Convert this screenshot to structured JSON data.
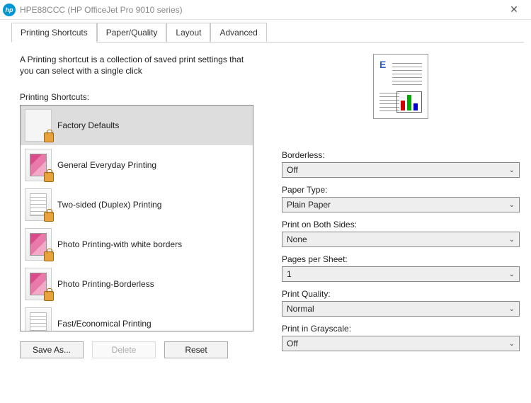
{
  "window": {
    "title": "HPE88CCC (HP OfficeJet Pro 9010 series)"
  },
  "tabs": [
    {
      "label": "Printing Shortcuts",
      "active": true
    },
    {
      "label": "Paper/Quality"
    },
    {
      "label": "Layout"
    },
    {
      "label": "Advanced"
    }
  ],
  "description": "A Printing shortcut is a collection of saved print settings that you can select with a single click",
  "shortcuts_label": "Printing Shortcuts:",
  "shortcuts": [
    {
      "label": "Factory Defaults",
      "thumb": "blank",
      "locked": true,
      "selected": true
    },
    {
      "label": "General Everyday Printing",
      "thumb": "photo",
      "locked": true
    },
    {
      "label": "Two-sided (Duplex) Printing",
      "thumb": "doc",
      "locked": true
    },
    {
      "label": "Photo Printing-with white borders",
      "thumb": "photo",
      "locked": true
    },
    {
      "label": "Photo Printing-Borderless",
      "thumb": "photo",
      "locked": true
    },
    {
      "label": "Fast/Economical Printing",
      "thumb": "doc",
      "locked": false
    }
  ],
  "buttons": {
    "save_as": "Save As...",
    "delete": "Delete",
    "reset": "Reset"
  },
  "settings": {
    "borderless": {
      "label": "Borderless:",
      "value": "Off"
    },
    "paper_type": {
      "label": "Paper Type:",
      "value": "Plain Paper"
    },
    "both_sides": {
      "label": "Print on Both Sides:",
      "value": "None"
    },
    "pages_per_sheet": {
      "label": "Pages per Sheet:",
      "value": "1"
    },
    "quality": {
      "label": "Print Quality:",
      "value": "Normal"
    },
    "grayscale": {
      "label": "Print in Grayscale:",
      "value": "Off"
    }
  }
}
